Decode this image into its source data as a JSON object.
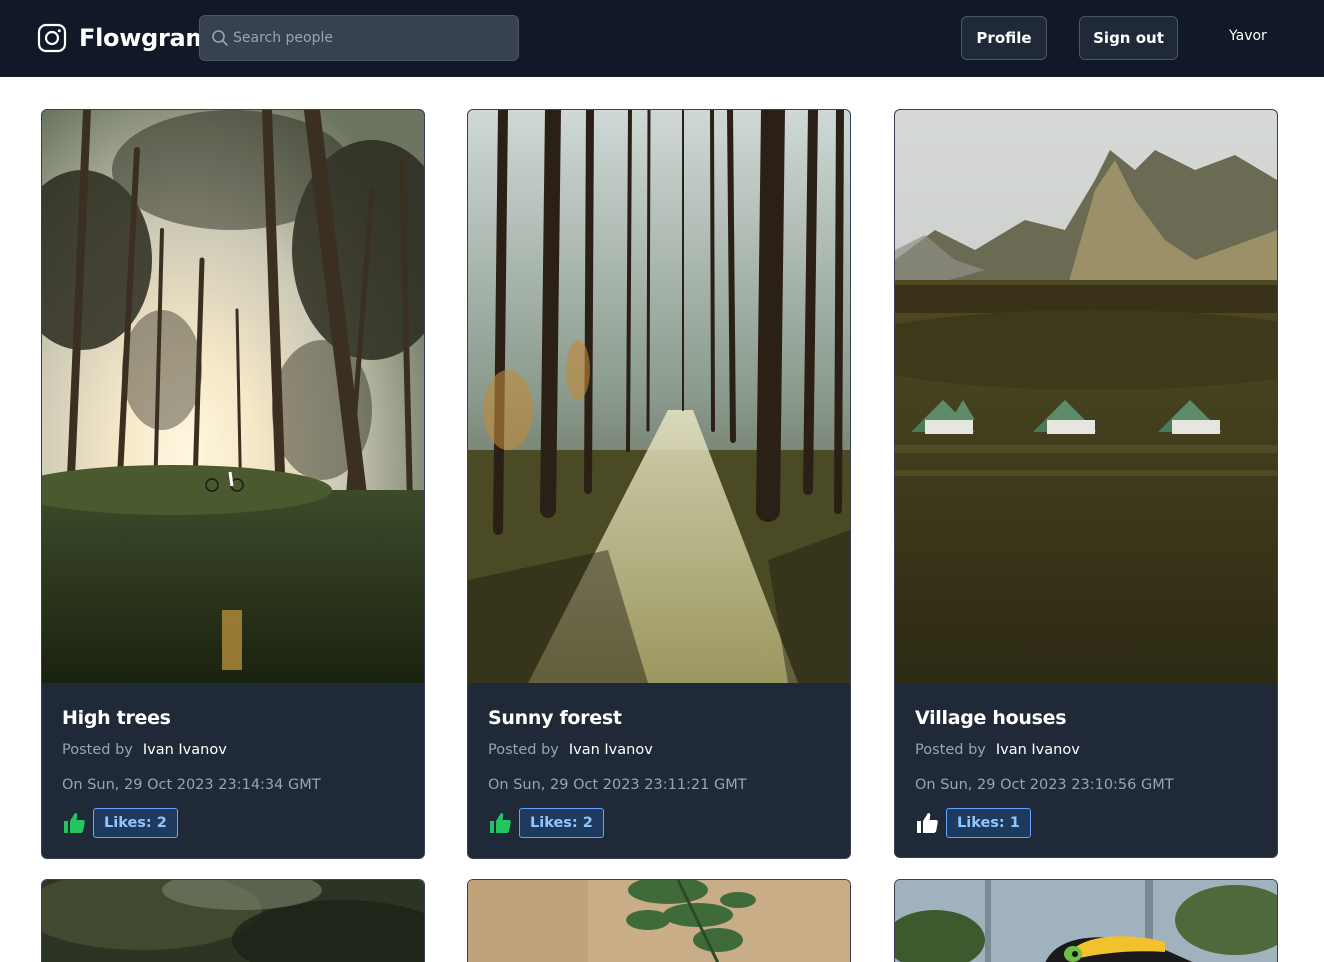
{
  "app": {
    "name": "Flowgram",
    "logo_icon": "instagram-camera-icon"
  },
  "search": {
    "placeholder": "Search people",
    "icon": "search-icon"
  },
  "nav": {
    "profile_label": "Profile",
    "signout_label": "Sign out",
    "username": "Yavor"
  },
  "colors": {
    "navbar": "#111827",
    "card": "#1f2937",
    "liked_thumb": "#22c55e",
    "unliked_thumb": "#ffffff",
    "likes_badge_border": "#60a5fa",
    "likes_badge_text": "#93c5fd"
  },
  "posts": [
    {
      "title": "High trees",
      "posted_by_label": "Posted by",
      "author": "Ivan Ivanov",
      "date": "On Sun, 29 Oct 2023 23:14:34 GMT",
      "likes": "Likes: 2",
      "liked": true,
      "image": "forest with tall pine trees and sunlight"
    },
    {
      "title": "Sunny forest",
      "posted_by_label": "Posted by",
      "author": "Ivan Ivanov",
      "date": "On Sun, 29 Oct 2023 23:11:21 GMT",
      "likes": "Likes: 2",
      "liked": true,
      "image": "sunlit forest path between pine trees"
    },
    {
      "title": "Village houses",
      "posted_by_label": "Posted by",
      "author": "Ivan Ivanov",
      "date": "On Sun, 29 Oct 2023 23:10:56 GMT",
      "likes": "Likes: 1",
      "liked": false,
      "image": "turf houses below a mountain"
    }
  ]
}
